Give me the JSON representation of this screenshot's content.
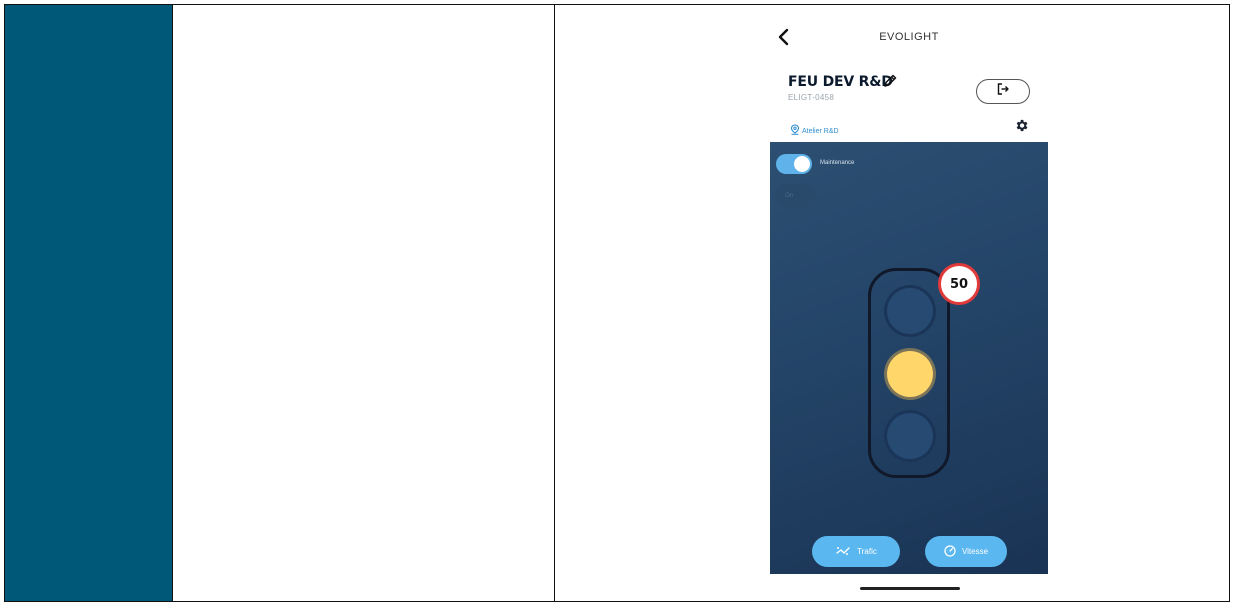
{
  "app": {
    "title": "EVOLIGHT"
  },
  "device": {
    "name": "FEU DEV R&D",
    "id": "ELIGT-0458"
  },
  "location": {
    "label": "Atelier R&D"
  },
  "maintenance": {
    "label": "Maintenance",
    "enabled": true,
    "state_label": "On"
  },
  "traffic_light": {
    "active_lamp": "yellow",
    "speed_limit": "50"
  },
  "buttons": {
    "trafic": "Trafic",
    "vitesse": "Vitesse"
  },
  "icons": {
    "back": "chevron-left-icon",
    "edit": "pencil-icon",
    "logout": "logout-icon",
    "location": "map-pin-icon",
    "settings": "gear-icon",
    "trafic": "sparkle-icon",
    "vitesse": "speedometer-icon"
  },
  "colors": {
    "accent_cell": "#005878",
    "panel": "#234467",
    "button": "#5bb7ef",
    "toggle_on": "#5fb2ea",
    "lamp_yellow": "#ffd66a",
    "speed_ring": "#e13a3a",
    "link": "#2f8fd0"
  }
}
